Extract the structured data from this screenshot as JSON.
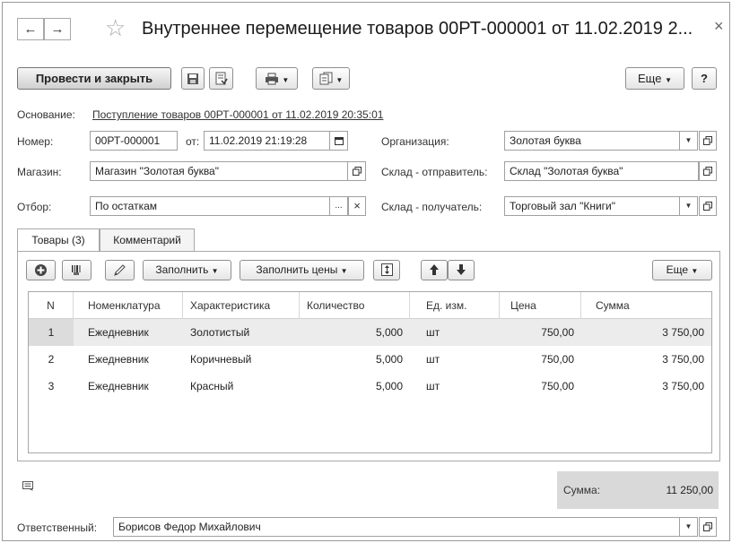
{
  "window": {
    "title": "Внутреннее перемещение товаров 00РТ-000001 от 11.02.2019 2...",
    "close_glyph": "×",
    "star_icon": "☆",
    "back_glyph": "←",
    "forward_glyph": "→"
  },
  "toolbar": {
    "post_close_label": "Провести и закрыть",
    "more_label": "Еще",
    "help_label": "?"
  },
  "basis": {
    "label": "Основание:",
    "link": "Поступление товаров 00РТ-000001 от 11.02.2019 20:35:01"
  },
  "number": {
    "label": "Номер:",
    "value": "00РТ-000001"
  },
  "date": {
    "label": "от:",
    "value": "11.02.2019 21:19:28"
  },
  "organization": {
    "label": "Организация:",
    "value": "Золотая буква"
  },
  "store": {
    "label": "Магазин:",
    "value": "Магазин \"Золотая буква\""
  },
  "sender": {
    "label": "Склад - отправитель:",
    "value": "Склад \"Золотая буква\""
  },
  "selection": {
    "label": "Отбор:",
    "value": "По остаткам",
    "clear_glyph": "×",
    "choose_glyph": "..."
  },
  "receiver": {
    "label": "Склад - получатель:",
    "value": "Торговый зал \"Книги\""
  },
  "tabs": [
    {
      "label": "Товары (3)",
      "active": true
    },
    {
      "label": "Комментарий",
      "active": false
    }
  ],
  "table_toolbar": {
    "fill_label": "Заполнить",
    "fill_prices_label": "Заполнить цены",
    "more_label": "Еще"
  },
  "table": {
    "columns": [
      "N",
      "Номенклатура",
      "Характеристика",
      "Количество",
      "Ед. изм.",
      "Цена",
      "Сумма"
    ],
    "rows": [
      [
        "1",
        "Ежедневник",
        "Золотистый",
        "5,000",
        "шт",
        "750,00",
        "3 750,00"
      ],
      [
        "2",
        "Ежедневник",
        "Коричневый",
        "5,000",
        "шт",
        "750,00",
        "3 750,00"
      ],
      [
        "3",
        "Ежедневник",
        "Красный",
        "5,000",
        "шт",
        "750,00",
        "3 750,00"
      ]
    ]
  },
  "total": {
    "label": "Сумма:",
    "value": "11 250,00"
  },
  "responsible": {
    "label": "Ответственный:",
    "value": "Борисов Федор Михайлович"
  },
  "colors": {
    "selected_row": "#ececec",
    "total_bg": "#d9d9d9",
    "border": "#a0a0a0"
  }
}
